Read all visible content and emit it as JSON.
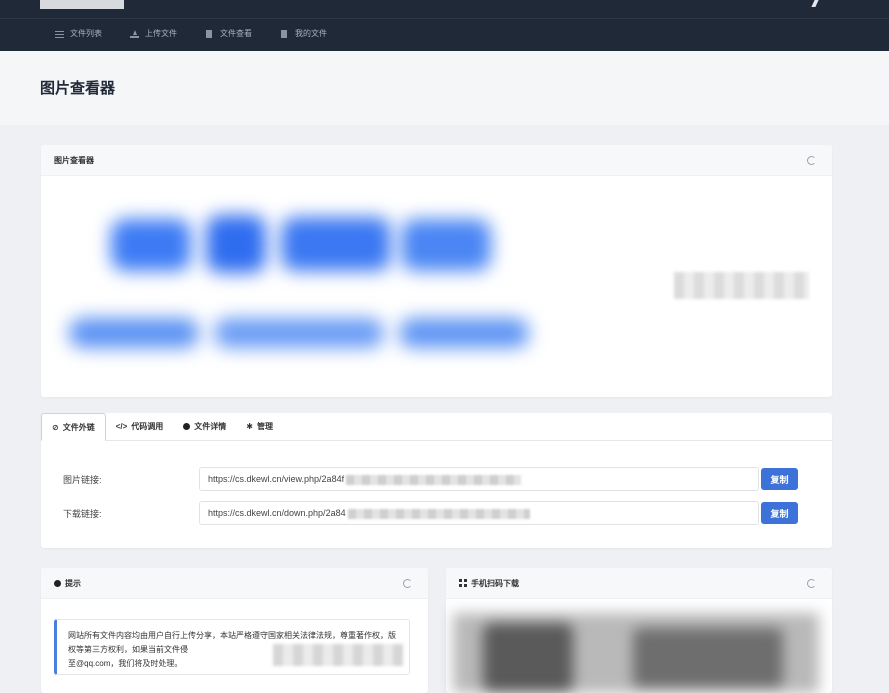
{
  "nav": {
    "items": [
      {
        "label": "文件列表",
        "icon": "list-icon"
      },
      {
        "label": "上传文件",
        "icon": "upload-icon"
      },
      {
        "label": "文件查看",
        "icon": "file-icon"
      },
      {
        "label": "我的文件",
        "icon": "file-icon"
      }
    ]
  },
  "page": {
    "title": "图片查看器"
  },
  "viewer": {
    "header": "图片查看器"
  },
  "links": {
    "tabs": [
      {
        "label": "文件外链",
        "icon": "link-icon"
      },
      {
        "label": "代码调用",
        "icon": "code-icon"
      },
      {
        "label": "文件详情",
        "icon": "info-icon"
      },
      {
        "label": "管理",
        "icon": "gear-icon"
      }
    ],
    "rows": [
      {
        "label": "图片链接:",
        "value": "https://cs.dkewl.cn/view.php/2a84f",
        "button": "复制"
      },
      {
        "label": "下载链接:",
        "value": "https://cs.dkewl.cn/down.php/2a84",
        "button": "复制"
      }
    ]
  },
  "notice": {
    "header": "提示",
    "text": "网站所有文件内容均由用户自行上传分享，本站严格遵守国家相关法律法规，尊重著作权，版权等第三方权利，如果当前文件侵",
    "text2": "至@qq.com，我们将及时处理。"
  },
  "qr": {
    "header": "手机扫码下载"
  },
  "colors": {
    "topbar": "#1f2937",
    "accent": "#3d72d9"
  }
}
